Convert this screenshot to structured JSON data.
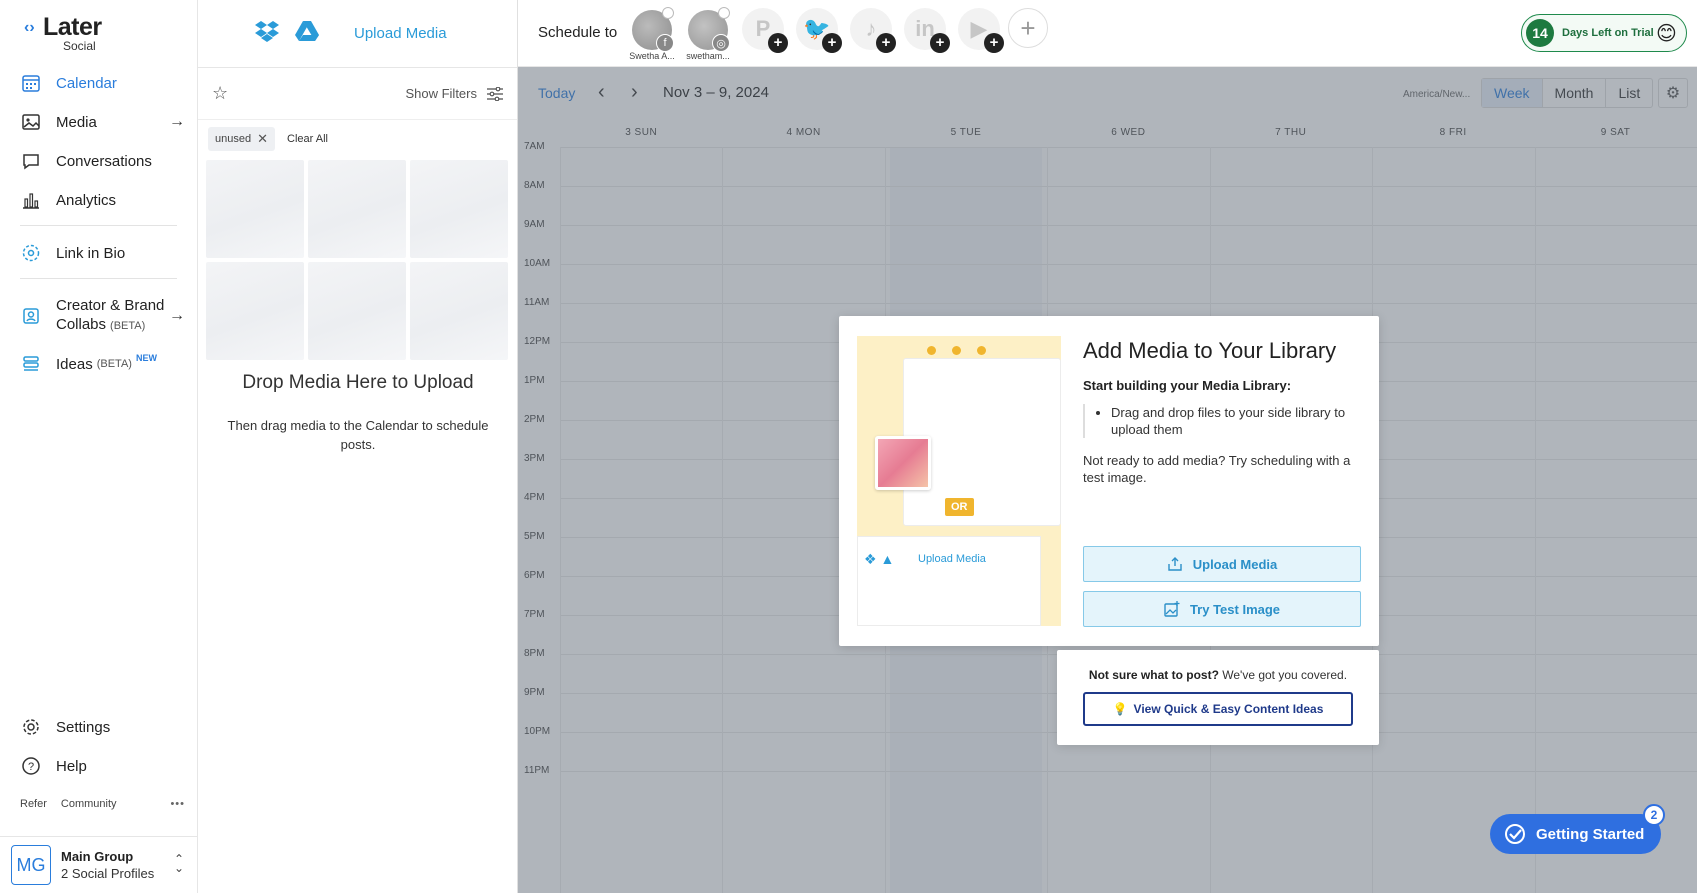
{
  "logo": {
    "name": "Later",
    "sub": "Social"
  },
  "nav": {
    "items": [
      {
        "label": "Calendar"
      },
      {
        "label": "Media"
      },
      {
        "label": "Conversations"
      },
      {
        "label": "Analytics"
      },
      {
        "label": "Link in Bio"
      },
      {
        "label": "Creator & Brand",
        "label2": "Collabs",
        "beta": "(BETA)"
      },
      {
        "label": "Ideas",
        "beta": "(BETA)",
        "new": "NEW"
      }
    ],
    "settings": "Settings",
    "help": "Help",
    "footer_links": [
      "Refer",
      "Community"
    ],
    "footer_more": "•••",
    "group": {
      "initials": "MG",
      "name": "Main Group",
      "sub": "2 Social Profiles"
    }
  },
  "media": {
    "upload_label": "Upload Media",
    "show_filters": "Show Filters",
    "tag": "unused",
    "clear_all": "Clear All",
    "drop_title": "Drop Media Here to Upload",
    "drop_sub": "Then drag media to the Calendar to schedule posts."
  },
  "topbar": {
    "schedule_to": "Schedule to",
    "profiles": [
      {
        "name": "Swetha A..."
      },
      {
        "name": "swetham..."
      }
    ],
    "trial": {
      "days": "14",
      "text": "Days Left on Trial",
      "emoji": "😊"
    }
  },
  "calendar": {
    "today": "Today",
    "range": "Nov 3 – 9, 2024",
    "timezone": "America/New...",
    "views": [
      "Week",
      "Month",
      "List"
    ],
    "selected_view": "Week",
    "days": [
      "3 SUN",
      "4 MON",
      "5 TUE",
      "6 WED",
      "7 THU",
      "8 FRI",
      "9 SAT"
    ],
    "hours": [
      "7AM",
      "8AM",
      "9AM",
      "10AM",
      "11AM",
      "12PM",
      "1PM",
      "2PM",
      "3PM",
      "4PM",
      "5PM",
      "6PM",
      "7PM",
      "8PM",
      "9PM",
      "10PM",
      "11PM"
    ]
  },
  "modal": {
    "title": "Add Media to Your Library",
    "subtitle": "Start building your Media Library:",
    "bullet": "Drag and drop files to your side library to upload them",
    "note": "Not ready to add media? Try scheduling with a test image.",
    "upload_button": "Upload Media",
    "test_button": "Try Test Image",
    "illustration": {
      "upload_text": "Upload Media",
      "or_text": "OR"
    }
  },
  "ideas": {
    "lead_bold": "Not sure what to post?",
    "lead_rest": " We've got you covered.",
    "button": "View Quick & Easy Content Ideas"
  },
  "getting_started": {
    "label": "Getting Started",
    "count": "2"
  },
  "colors": {
    "brand_blue": "#2a7ddc",
    "trial_green": "#1d7a40",
    "cta_blue": "#2f6fe0"
  }
}
